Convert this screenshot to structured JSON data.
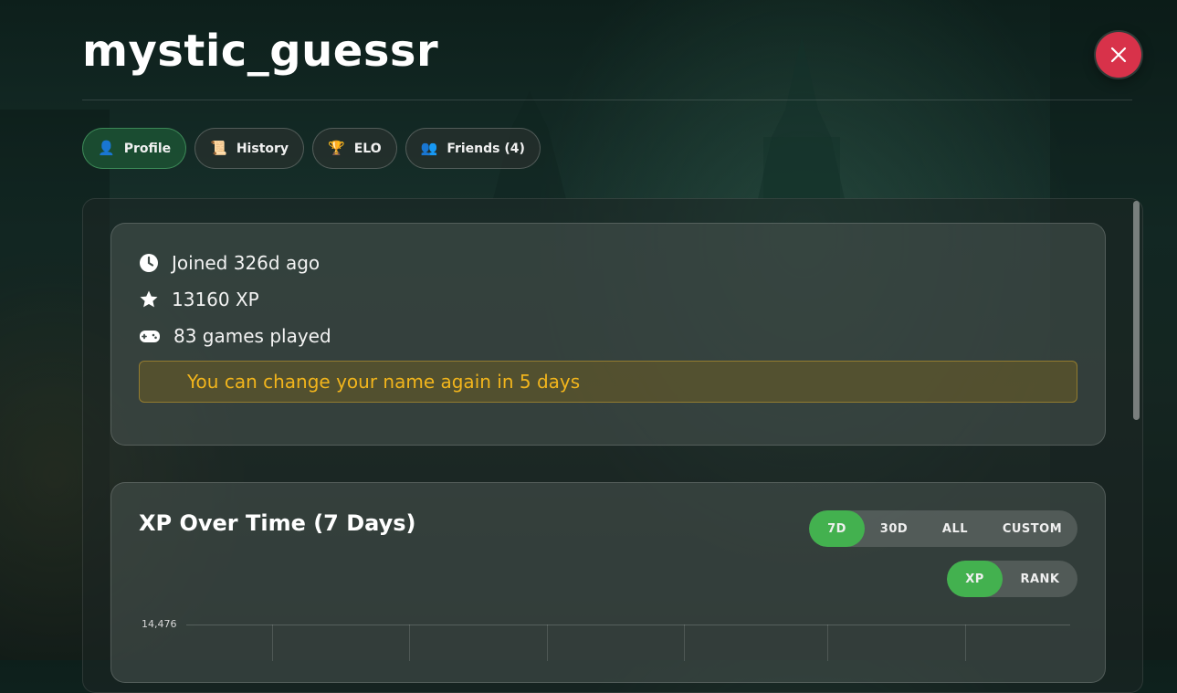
{
  "header": {
    "title": "mystic_guessr",
    "close_icon": "close-icon"
  },
  "tabs": [
    {
      "label": "Profile",
      "icon": "👤",
      "active": true
    },
    {
      "label": "History",
      "icon": "📜",
      "active": false
    },
    {
      "label": "ELO",
      "icon": "🏆",
      "active": false
    },
    {
      "label": "Friends (4)",
      "icon": "👥",
      "active": false
    }
  ],
  "stats": {
    "joined": "Joined 326d ago",
    "xp": "13160 XP",
    "games": "83 games played",
    "notice": "You can change your name again in 5 days"
  },
  "chart": {
    "title": "XP Over Time (7 Days)",
    "range_options": [
      {
        "label": "7D",
        "active": true
      },
      {
        "label": "30D",
        "active": false
      },
      {
        "label": "ALL",
        "active": false
      },
      {
        "label": "CUSTOM",
        "active": false
      }
    ],
    "metric_options": [
      {
        "label": "XP",
        "active": true
      },
      {
        "label": "RANK",
        "active": false
      }
    ],
    "y_top_label": "14,476"
  },
  "colors": {
    "accent": "#43b14f",
    "close": "#d8324a",
    "notice_text": "#f2b51c"
  }
}
